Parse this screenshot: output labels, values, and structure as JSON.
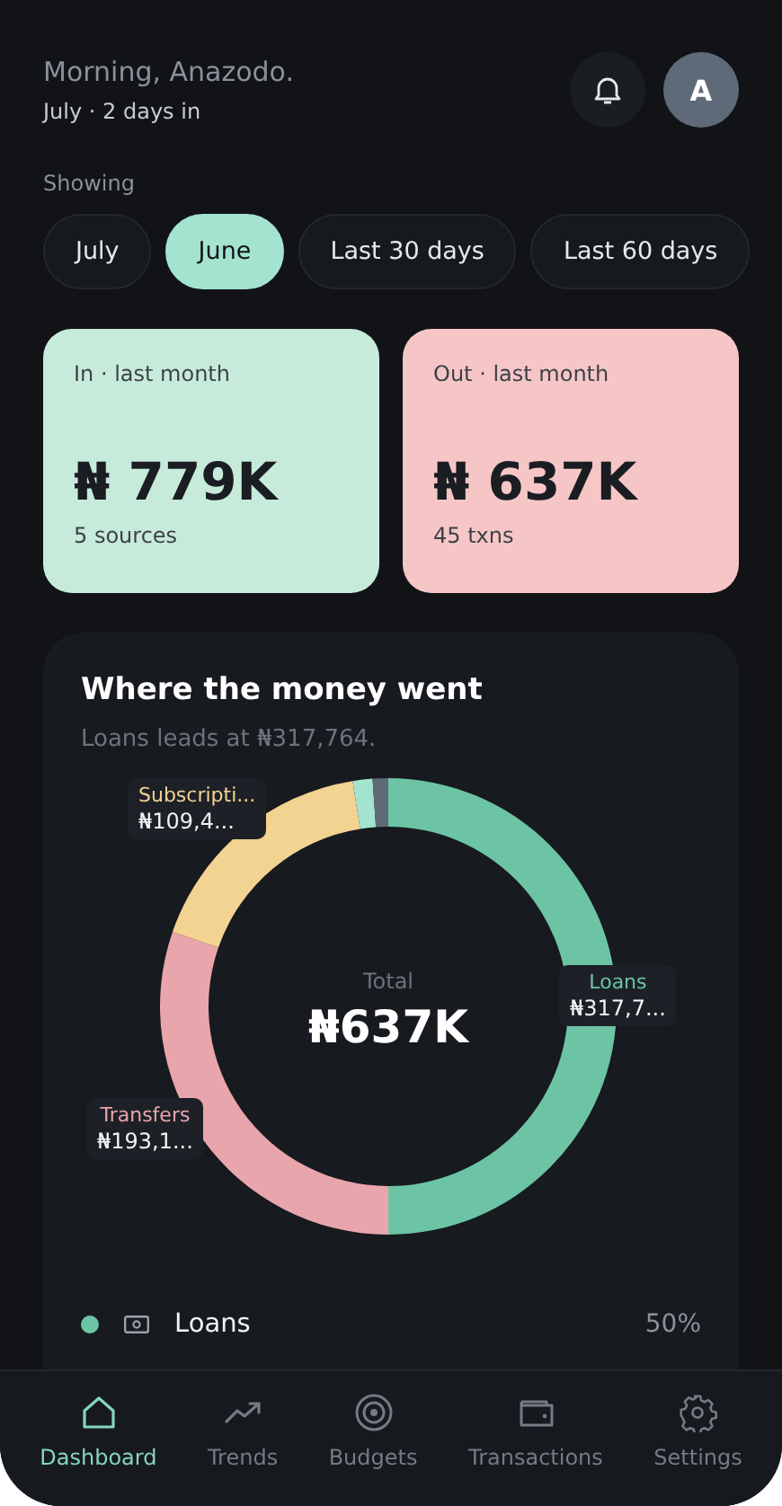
{
  "header": {
    "greeting": "Morning, Anazodo.",
    "subtitle": "July · 2 days in",
    "avatar": "A"
  },
  "filter": {
    "label": "Showing",
    "chips": [
      {
        "label": "July",
        "selected": false
      },
      {
        "label": "June",
        "selected": true
      },
      {
        "label": "Last 30 days",
        "selected": false
      },
      {
        "label": "Last 60 days",
        "selected": false
      }
    ]
  },
  "summary_cards": [
    {
      "kind": "in",
      "label": "In · last month",
      "amount": "₦ 779K",
      "detail": "5 sources"
    },
    {
      "kind": "out",
      "label": "Out · last month",
      "amount": "₦ 637K",
      "detail": "45 txns"
    }
  ],
  "spending": {
    "title": "Where the money went",
    "subtitle": "Loans leads at ₦317,764.",
    "total_label": "Total",
    "total": "₦637K",
    "chart_data": {
      "type": "donut",
      "values": [
        50,
        30.3,
        17.2,
        1.4,
        1.1
      ]
    },
    "slices": [
      {
        "color": "#6cc4a4"
      },
      {
        "color": "#e8a5ab"
      },
      {
        "color": "#f3d391"
      },
      {
        "color": "#a3e3cf"
      },
      {
        "color": "#5e6a78"
      }
    ],
    "callouts": [
      {
        "name": "Subscripti...",
        "amount": "₦109,4...",
        "color": "#f3d391"
      },
      {
        "name": "Loans",
        "amount": "₦317,7...",
        "color": "#6cc4a4"
      },
      {
        "name": "Transfers",
        "amount": "₦193,1...",
        "color": "#e8a5ab"
      }
    ],
    "legend": [
      {
        "name": "Loans",
        "percent": "50%",
        "color": "#6cc4a4"
      }
    ]
  },
  "nav": [
    {
      "label": "Dashboard",
      "selected": true
    },
    {
      "label": "Trends",
      "selected": false
    },
    {
      "label": "Budgets",
      "selected": false
    },
    {
      "label": "Transactions",
      "selected": false
    },
    {
      "label": "Settings",
      "selected": false
    }
  ]
}
